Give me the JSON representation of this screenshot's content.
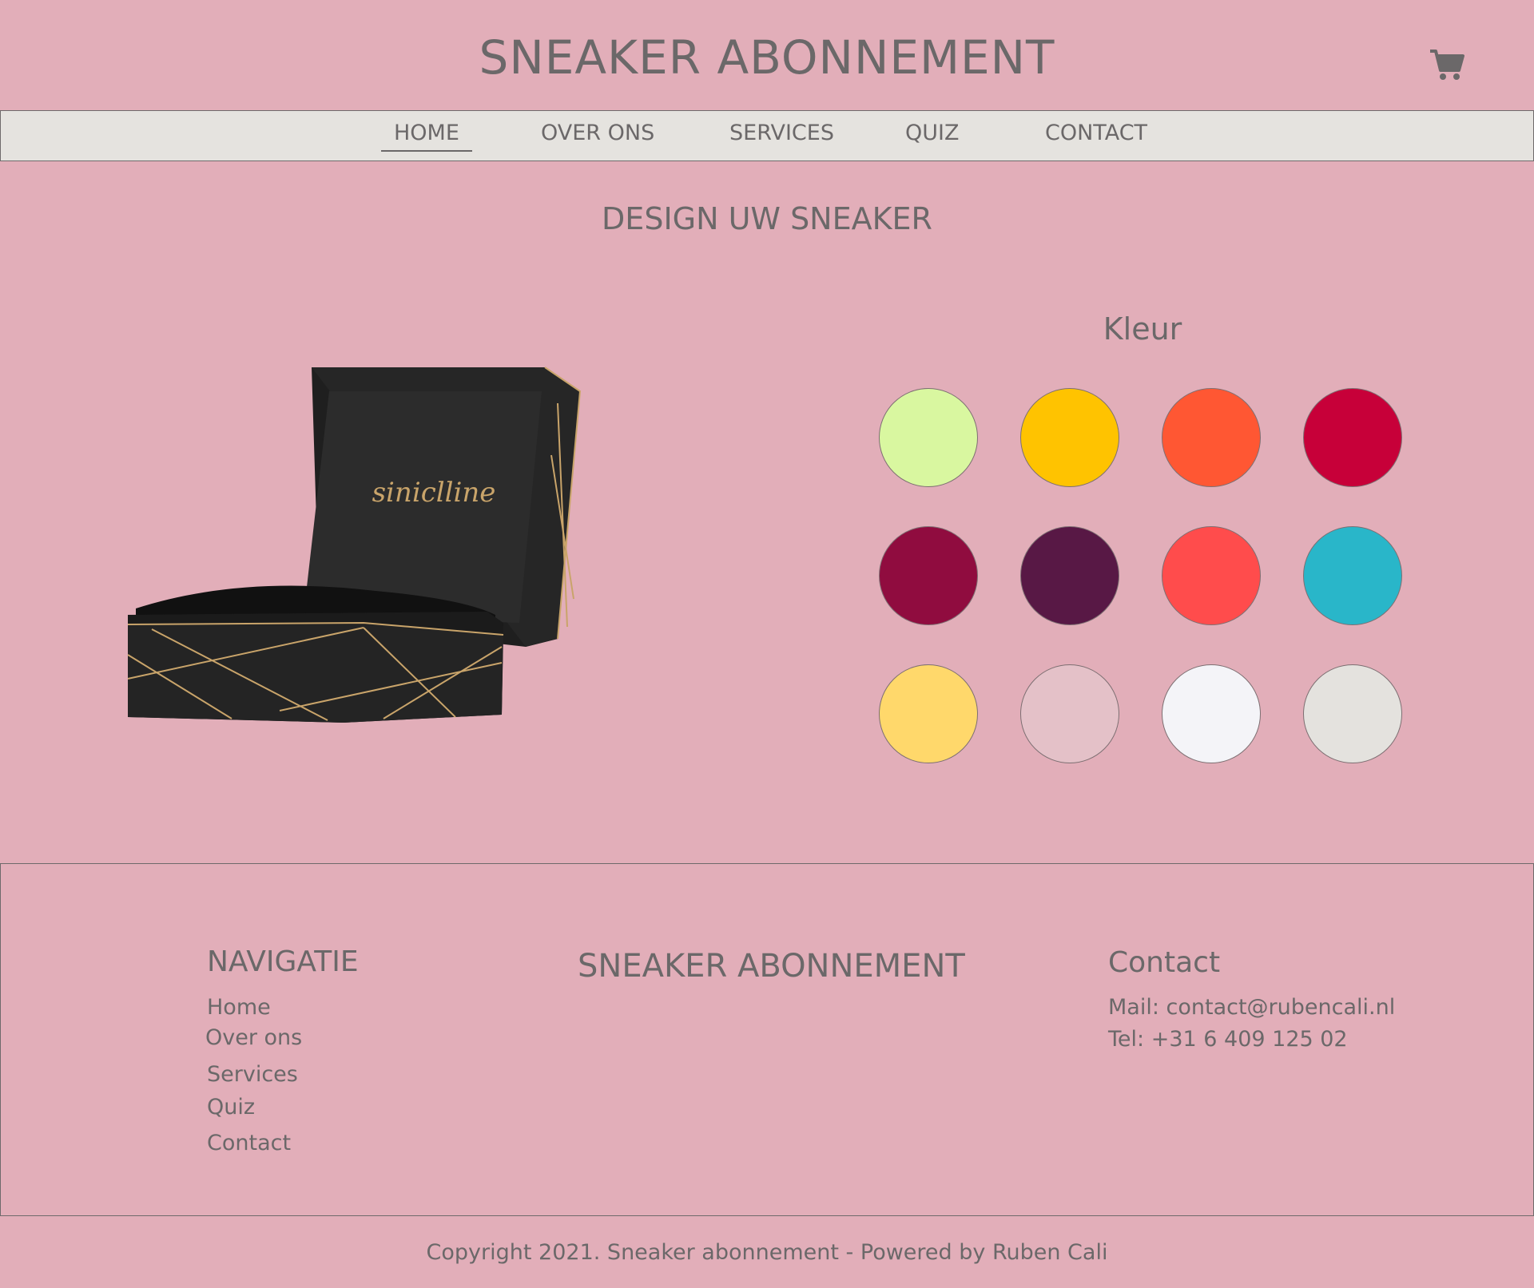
{
  "header": {
    "title": "SNEAKER ABONNEMENT",
    "cart_icon": "shopping-cart-icon"
  },
  "nav": {
    "items": [
      {
        "label": "HOME",
        "active": true
      },
      {
        "label": "OVER ONS"
      },
      {
        "label": "SERVICES"
      },
      {
        "label": "QUIZ"
      },
      {
        "label": "CONTACT"
      }
    ]
  },
  "main": {
    "title": "DESIGN UW SNEAKER",
    "product_image": {
      "brand_text": "siniclline",
      "description": "black gift box with gold lines"
    },
    "color_picker": {
      "title": "Kleur",
      "swatches": [
        "#d9f7a0",
        "#ffc300",
        "#ff5733",
        "#c70039",
        "#900c3f",
        "#581845",
        "#ff4c4c",
        "#29b6c9",
        "#ffd86b",
        "#e4c1c8",
        "#f4f4f8",
        "#e4e2de"
      ]
    }
  },
  "footer": {
    "navigation": {
      "title": "NAVIGATIE",
      "links": [
        "Home",
        "Over ons",
        "Services",
        "Quiz",
        "Contact"
      ]
    },
    "brand": "SNEAKER ABONNEMENT",
    "contact": {
      "title": "Contact",
      "mail": "Mail: contact@rubencali.nl",
      "tel": "Tel: +31 6 409 125 02"
    },
    "copyright": "Copyright 2021. Sneaker abonnement - Powered by Ruben Cali"
  },
  "colors": {
    "background": "#e2aeb9",
    "nav_background": "#e5e3df",
    "text": "#6b6869"
  }
}
